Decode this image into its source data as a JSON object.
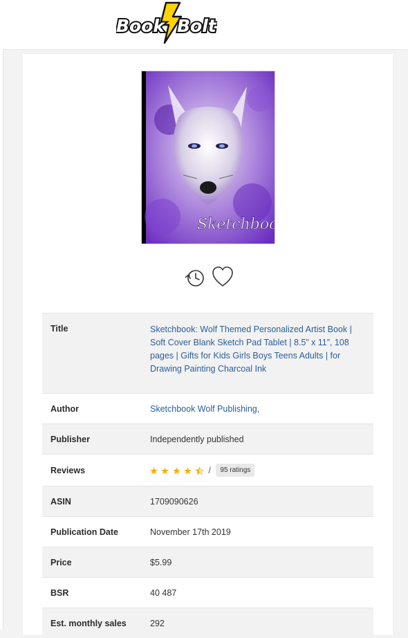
{
  "brand": {
    "logo_left": "Book",
    "logo_right": "Bolt"
  },
  "book": {
    "cover": {
      "title_text": "Sketchbook"
    },
    "icons": {
      "history": "history-clock-icon",
      "favorite": "heart-icon"
    },
    "details": {
      "title_label": "Title",
      "title_value": "Sketchbook: Wolf Themed Personalized Artist Book | Soft Cover Blank Sketch Pad Tablet | 8.5” x 11”, 108 pages | Gifts for Kids Girls Boys Teens Adults | for Drawing Painting Charcoal Ink",
      "author_label": "Author",
      "author_value": "Sketchbook Wolf Publishing,",
      "publisher_label": "Publisher",
      "publisher_value": "Independently published",
      "reviews_label": "Reviews",
      "reviews_rating": 4.5,
      "reviews_separator": "/",
      "reviews_count": "95 ratings",
      "asin_label": "ASIN",
      "asin_value": "1709090626",
      "pubdate_label": "Publication Date",
      "pubdate_value": "November 17th 2019",
      "price_label": "Price",
      "price_value": "$5.99",
      "bsr_label": "BSR",
      "bsr_value": "40 487",
      "sales_label": "Est. monthly sales",
      "sales_value": "292"
    }
  },
  "colors": {
    "link": "#2a5d9a",
    "star": "#f5b000",
    "logo_bolt": "#ffd400",
    "cover_purple": "#7a44c8"
  }
}
